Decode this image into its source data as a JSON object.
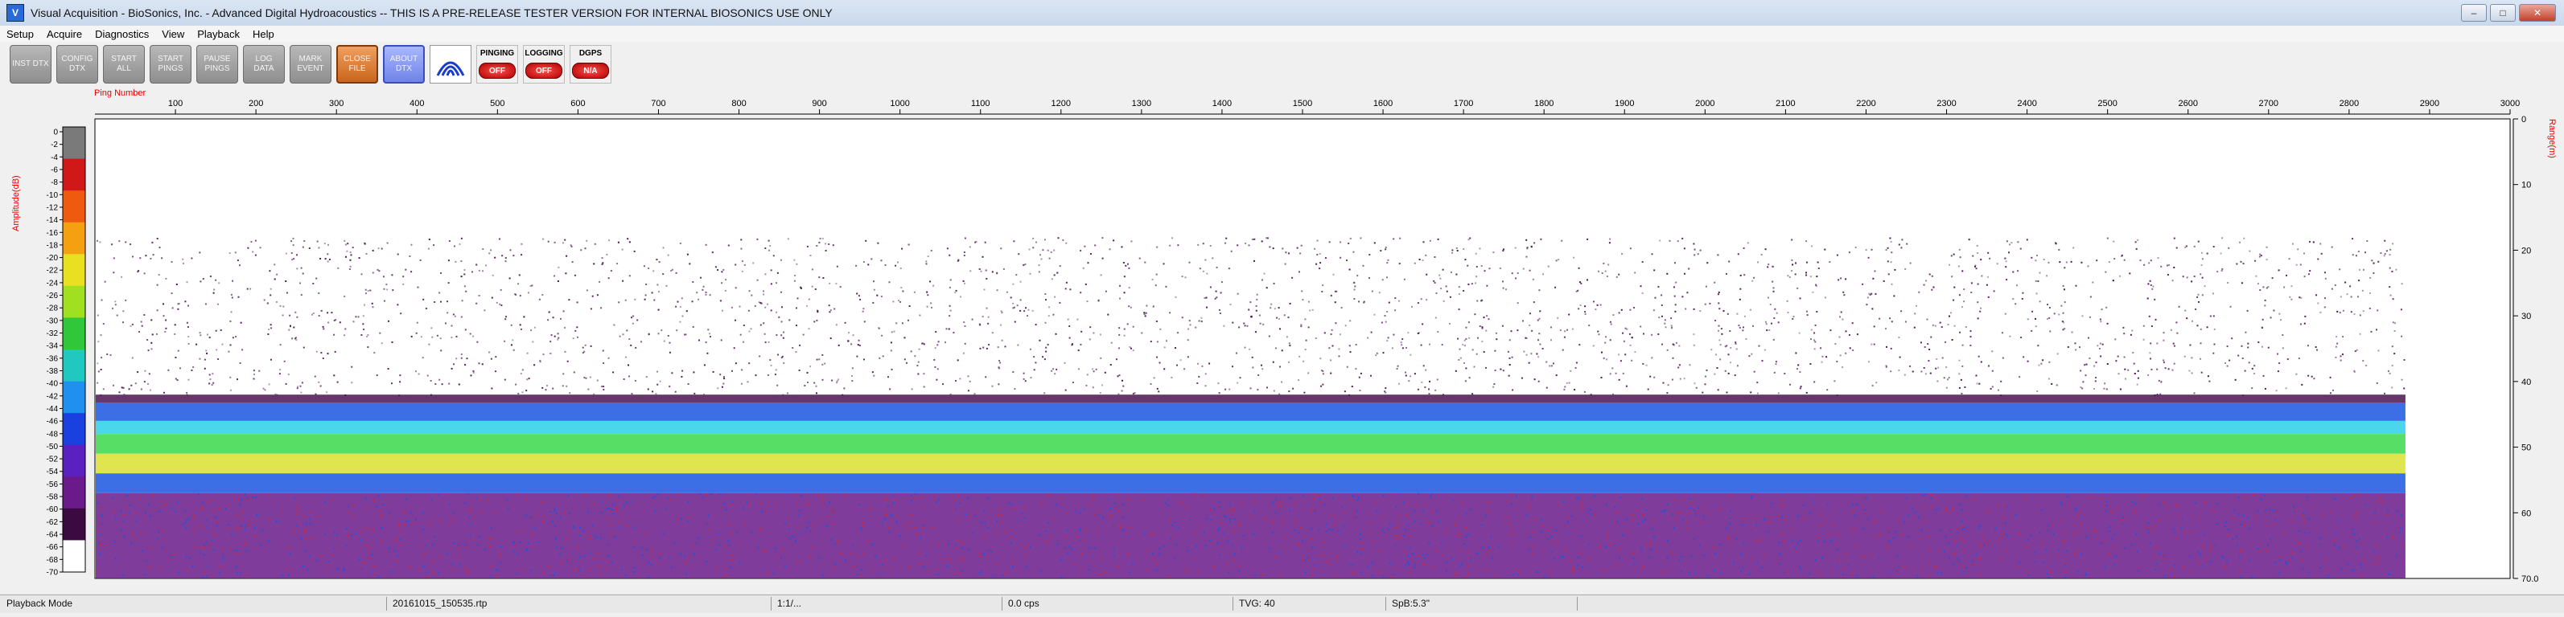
{
  "window": {
    "title": "Visual Acquisition  -  BioSonics, Inc.  -  Advanced Digital Hydroacoustics  -- THIS IS A PRE-RELEASE TESTER VERSION FOR INTERNAL BIOSONICS USE ONLY",
    "icon": "app-icon",
    "minimize_symbol": "–",
    "maximize_symbol": "□",
    "close_symbol": "✕"
  },
  "menu": [
    "Setup",
    "Acquire",
    "Diagnostics",
    "View",
    "Playback",
    "Help"
  ],
  "toolbar": {
    "buttons": [
      {
        "id": "inst-dtx",
        "label": "INST DTX",
        "style": "gray"
      },
      {
        "id": "config-dtx",
        "label": "CONFIG DTX",
        "style": "gray"
      },
      {
        "id": "start-all",
        "label": "START ALL",
        "style": "gray"
      },
      {
        "id": "start-pings",
        "label": "START PINGS",
        "style": "gray"
      },
      {
        "id": "pause-pings",
        "label": "PAUSE PINGS",
        "style": "gray"
      },
      {
        "id": "log-data",
        "label": "LOG DATA",
        "style": "gray"
      },
      {
        "id": "mark-event",
        "label": "MARK EVENT",
        "style": "gray"
      },
      {
        "id": "close-file",
        "label": "CLOSE FILE",
        "style": "orange"
      },
      {
        "id": "about-dtx",
        "label": "ABOUT DTX",
        "style": "blue"
      }
    ],
    "status": [
      {
        "id": "pinging",
        "label": "PINGING",
        "value": "OFF"
      },
      {
        "id": "logging",
        "label": "LOGGING",
        "value": "OFF"
      },
      {
        "id": "dgps",
        "label": "DGPS",
        "value": "N/A"
      }
    ]
  },
  "plot": {
    "x_axis_label": "Ping Number",
    "x_ticks": [
      100,
      200,
      300,
      400,
      500,
      600,
      700,
      800,
      900,
      1000,
      1100,
      1200,
      1300,
      1400,
      1500,
      1600,
      1700,
      1800,
      1900,
      2000,
      2100,
      2200,
      2300,
      2400,
      2500,
      2600,
      2700,
      2800,
      2900,
      3000
    ],
    "x_range": [
      0,
      3000
    ],
    "range_label": "Range(m)",
    "range_ticks": [
      "0",
      "10",
      "20",
      "30",
      "40",
      "50",
      "60",
      "70.0"
    ],
    "range_range": [
      0,
      70
    ],
    "amplitude_label": "Amplitude(dB)",
    "amplitude_ticks": [
      "0",
      "-2",
      "-4",
      "-6",
      "-8",
      "-10",
      "-12",
      "-14",
      "-16",
      "-18",
      "-20",
      "-22",
      "-24",
      "-26",
      "-28",
      "-30",
      "-32",
      "-34",
      "-36",
      "-38",
      "-40",
      "-42",
      "-44",
      "-46",
      "-48",
      "-50",
      "-52",
      "-54",
      "-56",
      "-58",
      "-60",
      "-62",
      "-64",
      "-66",
      "-68",
      "-70"
    ],
    "data_end_ping": 2870,
    "layers": {
      "scatter_top_m": 18,
      "bottom_m": 42,
      "strong_band_m": [
        48,
        54
      ],
      "sub_bottom_m": [
        55,
        70
      ]
    },
    "colors": {
      "background": "#ffffff",
      "weak": "#4a1450",
      "bottom_blue": "#1a55e0",
      "band_green": "#38d84a",
      "band_yellow": "#d8e030",
      "cyan": "#2ad0e8",
      "deep": "#6a1a8a",
      "deep_red": "#c8283c"
    }
  },
  "statusbar": {
    "mode": "Playback Mode",
    "file": "20161015_150535.rtp",
    "ping_progress": "1:1/...",
    "rate": "0.0 cps",
    "tvg": "TVG: 40",
    "spb": "SpB:5.3\""
  }
}
